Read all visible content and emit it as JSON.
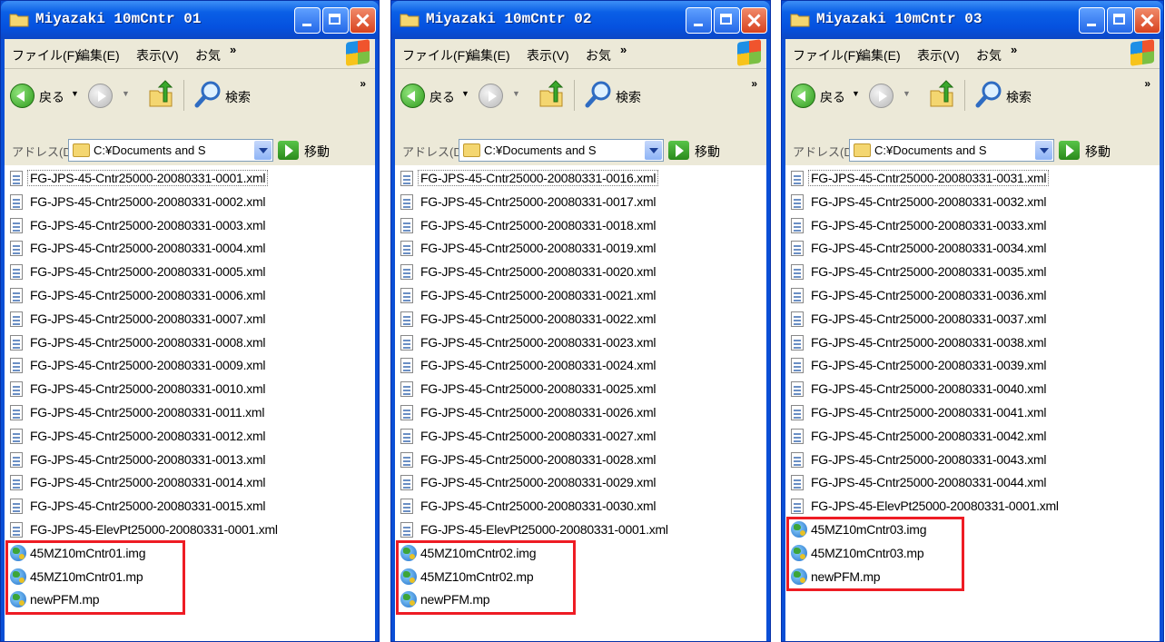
{
  "colors": {
    "titlebar": "#0a5fe6",
    "chrome": "#ece9d8",
    "highlight": "#ee1c24"
  },
  "toolbar_chevron": "»",
  "menu_chevron": "»",
  "windows": [
    {
      "title": "Miyazaki 10mCntr 01",
      "menu": [
        "ファイル(F)",
        "編集(E)",
        "表示(V)",
        "お気"
      ],
      "back_label": "戻る",
      "search_label": "検索",
      "address_label": "アドレス(D)",
      "address_value": "C:¥Documents and S",
      "go_label": "移動",
      "files": [
        {
          "name": "FG-JPS-45-Cntr25000-20080331-0001.xml",
          "icon": "xml-file-icon"
        },
        {
          "name": "FG-JPS-45-Cntr25000-20080331-0002.xml",
          "icon": "xml-file-icon"
        },
        {
          "name": "FG-JPS-45-Cntr25000-20080331-0003.xml",
          "icon": "xml-file-icon"
        },
        {
          "name": "FG-JPS-45-Cntr25000-20080331-0004.xml",
          "icon": "xml-file-icon"
        },
        {
          "name": "FG-JPS-45-Cntr25000-20080331-0005.xml",
          "icon": "xml-file-icon"
        },
        {
          "name": "FG-JPS-45-Cntr25000-20080331-0006.xml",
          "icon": "xml-file-icon"
        },
        {
          "name": "FG-JPS-45-Cntr25000-20080331-0007.xml",
          "icon": "xml-file-icon"
        },
        {
          "name": "FG-JPS-45-Cntr25000-20080331-0008.xml",
          "icon": "xml-file-icon"
        },
        {
          "name": "FG-JPS-45-Cntr25000-20080331-0009.xml",
          "icon": "xml-file-icon"
        },
        {
          "name": "FG-JPS-45-Cntr25000-20080331-0010.xml",
          "icon": "xml-file-icon"
        },
        {
          "name": "FG-JPS-45-Cntr25000-20080331-0011.xml",
          "icon": "xml-file-icon"
        },
        {
          "name": "FG-JPS-45-Cntr25000-20080331-0012.xml",
          "icon": "xml-file-icon"
        },
        {
          "name": "FG-JPS-45-Cntr25000-20080331-0013.xml",
          "icon": "xml-file-icon"
        },
        {
          "name": "FG-JPS-45-Cntr25000-20080331-0014.xml",
          "icon": "xml-file-icon"
        },
        {
          "name": "FG-JPS-45-Cntr25000-20080331-0015.xml",
          "icon": "xml-file-icon"
        },
        {
          "name": "FG-JPS-45-ElevPt25000-20080331-0001.xml",
          "icon": "xml-file-icon"
        },
        {
          "name": "45MZ10mCntr01.img",
          "icon": "globe-icon"
        },
        {
          "name": "45MZ10mCntr01.mp",
          "icon": "globe-icon"
        },
        {
          "name": "newPFM.mp",
          "icon": "globe-icon"
        }
      ]
    },
    {
      "title": "Miyazaki 10mCntr 02",
      "menu": [
        "ファイル(F)",
        "編集(E)",
        "表示(V)",
        "お気"
      ],
      "back_label": "戻る",
      "search_label": "検索",
      "address_label": "アドレス(D)",
      "address_value": "C:¥Documents and S",
      "go_label": "移動",
      "files": [
        {
          "name": "FG-JPS-45-Cntr25000-20080331-0016.xml",
          "icon": "xml-file-icon"
        },
        {
          "name": "FG-JPS-45-Cntr25000-20080331-0017.xml",
          "icon": "xml-file-icon"
        },
        {
          "name": "FG-JPS-45-Cntr25000-20080331-0018.xml",
          "icon": "xml-file-icon"
        },
        {
          "name": "FG-JPS-45-Cntr25000-20080331-0019.xml",
          "icon": "xml-file-icon"
        },
        {
          "name": "FG-JPS-45-Cntr25000-20080331-0020.xml",
          "icon": "xml-file-icon"
        },
        {
          "name": "FG-JPS-45-Cntr25000-20080331-0021.xml",
          "icon": "xml-file-icon"
        },
        {
          "name": "FG-JPS-45-Cntr25000-20080331-0022.xml",
          "icon": "xml-file-icon"
        },
        {
          "name": "FG-JPS-45-Cntr25000-20080331-0023.xml",
          "icon": "xml-file-icon"
        },
        {
          "name": "FG-JPS-45-Cntr25000-20080331-0024.xml",
          "icon": "xml-file-icon"
        },
        {
          "name": "FG-JPS-45-Cntr25000-20080331-0025.xml",
          "icon": "xml-file-icon"
        },
        {
          "name": "FG-JPS-45-Cntr25000-20080331-0026.xml",
          "icon": "xml-file-icon"
        },
        {
          "name": "FG-JPS-45-Cntr25000-20080331-0027.xml",
          "icon": "xml-file-icon"
        },
        {
          "name": "FG-JPS-45-Cntr25000-20080331-0028.xml",
          "icon": "xml-file-icon"
        },
        {
          "name": "FG-JPS-45-Cntr25000-20080331-0029.xml",
          "icon": "xml-file-icon"
        },
        {
          "name": "FG-JPS-45-Cntr25000-20080331-0030.xml",
          "icon": "xml-file-icon"
        },
        {
          "name": "FG-JPS-45-ElevPt25000-20080331-0001.xml",
          "icon": "xml-file-icon"
        },
        {
          "name": "45MZ10mCntr02.img",
          "icon": "globe-icon"
        },
        {
          "name": "45MZ10mCntr02.mp",
          "icon": "globe-icon"
        },
        {
          "name": "newPFM.mp",
          "icon": "globe-icon"
        }
      ]
    },
    {
      "title": "Miyazaki 10mCntr 03",
      "menu": [
        "ファイル(F)",
        "編集(E)",
        "表示(V)",
        "お気"
      ],
      "back_label": "戻る",
      "search_label": "検索",
      "address_label": "アドレス(D)",
      "address_value": "C:¥Documents and S",
      "go_label": "移動",
      "files": [
        {
          "name": "FG-JPS-45-Cntr25000-20080331-0031.xml",
          "icon": "xml-file-icon"
        },
        {
          "name": "FG-JPS-45-Cntr25000-20080331-0032.xml",
          "icon": "xml-file-icon"
        },
        {
          "name": "FG-JPS-45-Cntr25000-20080331-0033.xml",
          "icon": "xml-file-icon"
        },
        {
          "name": "FG-JPS-45-Cntr25000-20080331-0034.xml",
          "icon": "xml-file-icon"
        },
        {
          "name": "FG-JPS-45-Cntr25000-20080331-0035.xml",
          "icon": "xml-file-icon"
        },
        {
          "name": "FG-JPS-45-Cntr25000-20080331-0036.xml",
          "icon": "xml-file-icon"
        },
        {
          "name": "FG-JPS-45-Cntr25000-20080331-0037.xml",
          "icon": "xml-file-icon"
        },
        {
          "name": "FG-JPS-45-Cntr25000-20080331-0038.xml",
          "icon": "xml-file-icon"
        },
        {
          "name": "FG-JPS-45-Cntr25000-20080331-0039.xml",
          "icon": "xml-file-icon"
        },
        {
          "name": "FG-JPS-45-Cntr25000-20080331-0040.xml",
          "icon": "xml-file-icon"
        },
        {
          "name": "FG-JPS-45-Cntr25000-20080331-0041.xml",
          "icon": "xml-file-icon"
        },
        {
          "name": "FG-JPS-45-Cntr25000-20080331-0042.xml",
          "icon": "xml-file-icon"
        },
        {
          "name": "FG-JPS-45-Cntr25000-20080331-0043.xml",
          "icon": "xml-file-icon"
        },
        {
          "name": "FG-JPS-45-Cntr25000-20080331-0044.xml",
          "icon": "xml-file-icon"
        },
        {
          "name": "FG-JPS-45-ElevPt25000-20080331-0001.xml",
          "icon": "xml-file-icon"
        },
        {
          "name": "45MZ10mCntr03.img",
          "icon": "globe-icon"
        },
        {
          "name": "45MZ10mCntr03.mp",
          "icon": "globe-icon"
        },
        {
          "name": "newPFM.mp",
          "icon": "globe-icon"
        }
      ]
    }
  ]
}
